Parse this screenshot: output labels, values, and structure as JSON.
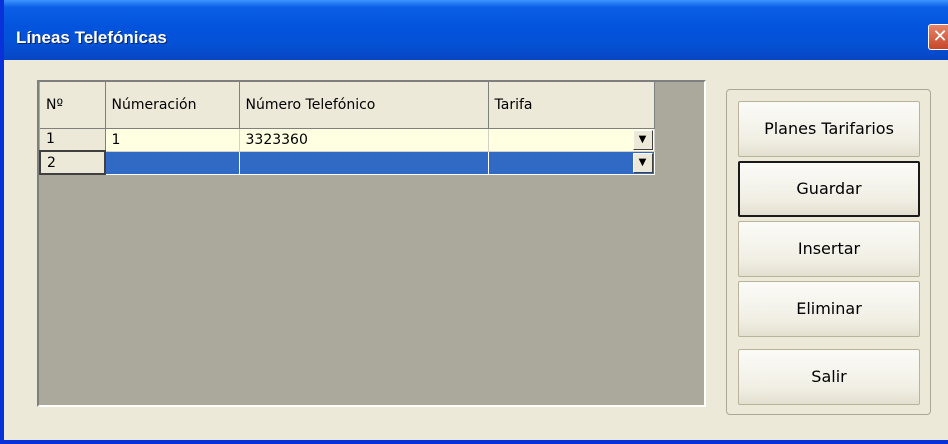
{
  "window": {
    "title": "Líneas Telefónicas",
    "close_glyph": "✕"
  },
  "grid": {
    "columns": [
      "Nº",
      "Númeración",
      "Número Telefónico",
      "Tarifa"
    ],
    "rows": [
      {
        "no": "1",
        "numeracion": "1",
        "telefono": "3323360",
        "tarifa": ""
      },
      {
        "no": "2",
        "numeracion": "",
        "telefono": "",
        "tarifa": ""
      }
    ],
    "dropdown_glyph": "▼"
  },
  "buttons": {
    "planes": "Planes Tarifarios",
    "guardar": "Guardar",
    "insertar": "Insertar",
    "eliminar": "Eliminar",
    "salir": "Salir"
  },
  "colors": {
    "selection": "#316ac5",
    "title_bar": "#0453dd",
    "row_cream": "#ffffe1"
  }
}
